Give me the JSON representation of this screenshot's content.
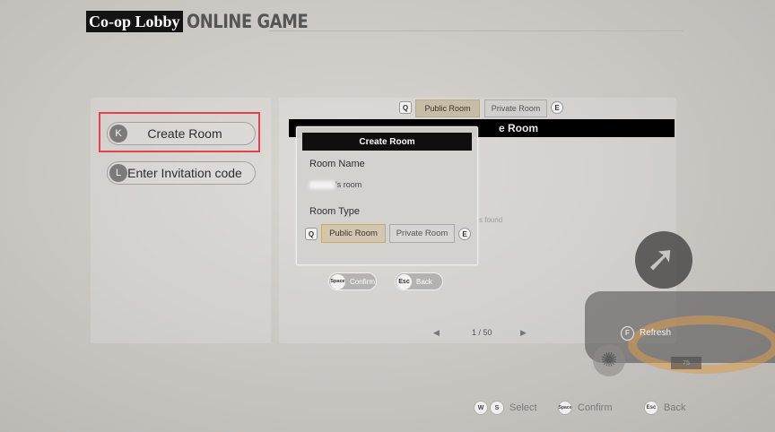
{
  "header": {
    "coop_label": "Co-op Lobby",
    "title": "ONLINE GAME"
  },
  "left_menu": {
    "create_room": {
      "key": "K",
      "label": "Create Room"
    },
    "enter_invitation": {
      "key": "L",
      "label": "Enter Invitation code"
    }
  },
  "room_list": {
    "tab_prev_key": "Q",
    "tab_next_key": "E",
    "tabs": [
      {
        "label": "Public Room",
        "active": true
      },
      {
        "label": "Private Room",
        "active": false
      }
    ],
    "header_partial": "e Room",
    "empty_text_partial": "s found",
    "page_indicator": "1 / 50",
    "prev_arrow": "◀",
    "next_arrow": "▶",
    "refresh": {
      "key": "F",
      "label": "Refresh"
    }
  },
  "modal": {
    "title": "Create Room",
    "room_name_label": "Room Name",
    "room_name_value": "'s room",
    "room_type_label": "Room Type",
    "type_prev_key": "Q",
    "type_next_key": "E",
    "type_options": [
      {
        "label": "Public Room",
        "selected": true
      },
      {
        "label": "Private Room",
        "selected": false
      }
    ],
    "confirm": {
      "key": "Space",
      "label": "Confirm"
    },
    "back": {
      "key": "Esc",
      "label": "Back"
    }
  },
  "bottom_hints": {
    "select": {
      "keys": [
        "W",
        "S"
      ],
      "label": "Select"
    },
    "confirm": {
      "key": "Space",
      "label": "Confirm"
    },
    "back": {
      "key": "Esc",
      "label": "Back"
    }
  },
  "background": {
    "tag_text": "75"
  },
  "colors": {
    "highlight": "#e0434b",
    "active_tab": "#c7bca6",
    "title_bar": "#000000"
  }
}
